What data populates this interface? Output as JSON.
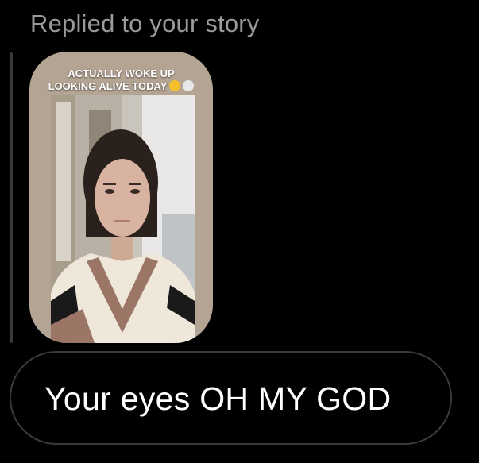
{
  "header": {
    "text": "Replied to your story"
  },
  "story": {
    "caption_line1": "ACTUALLY WOKE UP",
    "caption_line2": "LOOKING ALIVE TODAY",
    "emoji1": "rolling-on-floor-laughing-emoji",
    "emoji2": "skull-emoji",
    "background_color": "#b4a493"
  },
  "message": {
    "text": "Your eyes OH MY GOD"
  }
}
